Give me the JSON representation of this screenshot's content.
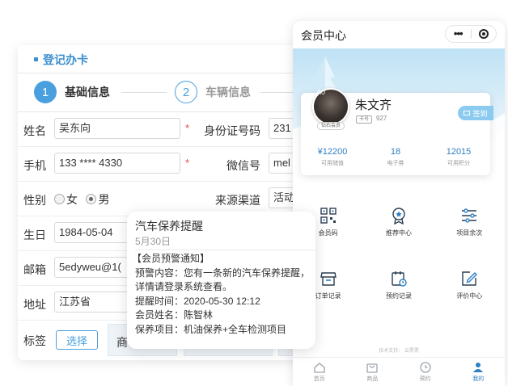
{
  "form": {
    "title": "登记办卡",
    "steps": [
      {
        "num": "1",
        "label": "基础信息"
      },
      {
        "num": "2",
        "label": "车辆信息"
      }
    ],
    "name_label": "姓名",
    "name_value": "吴东向",
    "idcard_label": "身份证号码",
    "idcard_value": "231",
    "phone_label": "手机",
    "phone_value": "133 **** 4330",
    "wechat_label": "微信号",
    "wechat_value": "mel",
    "gender_label": "性别",
    "gender_options": [
      "女",
      "男"
    ],
    "gender_selected": "男",
    "source_label": "来源渠道",
    "source_value": "活动",
    "birthday_label": "生日",
    "birthday_value": "1984-05-04",
    "email_label": "邮箱",
    "email_value": "5edyweu@1(",
    "address_label": "地址",
    "address_value": "江苏省",
    "tags_label": "标签",
    "tags_select_button": "选择",
    "tags_visible_text": "商",
    "required_mark": "*"
  },
  "phone": {
    "title": "会员中心",
    "capsule_menu": "•••",
    "member": {
      "name": "朱文齐",
      "avatar_badge": "钻石会员",
      "avatar_overlay": "A0",
      "card_chip": "卡号",
      "card_number": "927",
      "checkin_label": "签到"
    },
    "stats": [
      {
        "value": "¥12200",
        "label": "可用储值"
      },
      {
        "value": "18",
        "label": "电子券"
      },
      {
        "value": "12015",
        "label": "可用积分"
      }
    ],
    "menu_row1": [
      {
        "label": "会员码",
        "icon": "qr-code-icon"
      },
      {
        "label": "推荐中心",
        "icon": "badge-icon"
      },
      {
        "label": "项目余次",
        "icon": "sliders-icon"
      }
    ],
    "menu_row2": [
      {
        "label": "订单记录",
        "icon": "store-icon"
      },
      {
        "label": "预约记录",
        "icon": "calendar-icon"
      },
      {
        "label": "评价中心",
        "icon": "edit-icon"
      }
    ],
    "footer_note": "技术支持：  云票票",
    "tabs": [
      {
        "label": "首页",
        "icon": "home-icon",
        "active": false
      },
      {
        "label": "商品",
        "icon": "bag-icon",
        "active": false
      },
      {
        "label": "预约",
        "icon": "clock-icon",
        "active": false
      },
      {
        "label": "我的",
        "icon": "user-icon",
        "active": true
      }
    ],
    "accent_color": "#2e7fc4"
  },
  "popup": {
    "title": "汽车保养提醒",
    "date": "5月30日",
    "heading": "【会员预警通知】",
    "content_line1": "预警内容：您有一条新的汽车保养提醒，",
    "content_line2": "详情请登录系统查看。",
    "time_line": "提醒时间：2020-05-30 12:12",
    "member_line": "会员姓名：陈智林",
    "project_line": "保养项目：机油保养+全车检测项目"
  }
}
